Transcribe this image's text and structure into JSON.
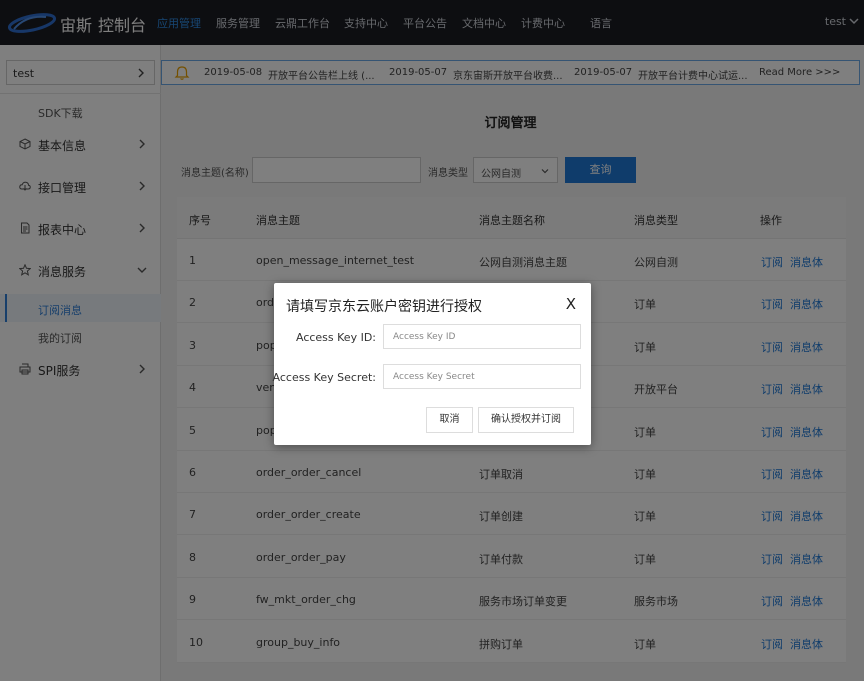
{
  "header": {
    "brand": "宙斯",
    "console": "控制台",
    "nav": [
      {
        "label": "应用管理",
        "active": true
      },
      {
        "label": "服务管理"
      },
      {
        "label": "云鼎工作台"
      },
      {
        "label": "支持中心"
      },
      {
        "label": "平台公告"
      },
      {
        "label": "文档中心"
      },
      {
        "label": "计费中心"
      },
      {
        "label": "语言"
      }
    ],
    "user": "test"
  },
  "sidebar": {
    "app_select": "test",
    "sdk_label": "SDK下载",
    "items": [
      {
        "label": "基本信息",
        "icon": "cube-icon"
      },
      {
        "label": "接口管理",
        "icon": "cloud-icon"
      },
      {
        "label": "报表中心",
        "icon": "document-icon"
      },
      {
        "label": "消息服务",
        "icon": "star-icon",
        "expanded": true
      },
      {
        "label": "SPI服务",
        "icon": "printer-icon"
      }
    ],
    "sub_items": [
      {
        "label": "订阅消息",
        "active": true
      },
      {
        "label": "我的订阅"
      }
    ]
  },
  "notice": {
    "items": [
      {
        "date": "2019-05-08",
        "text": "开放平台公告栏上线 (..."
      },
      {
        "date": "2019-05-07",
        "text": "京东宙斯开放平台收费..."
      },
      {
        "date": "2019-05-07",
        "text": "开放平台计费中心试运..."
      }
    ],
    "more": "Read More >>>"
  },
  "main": {
    "title": "订阅管理",
    "filter": {
      "topic_label": "消息主题(名称)",
      "topic_value": "",
      "type_label": "消息类型",
      "type_value": "公网自测",
      "query_button": "查询"
    },
    "table": {
      "headers": [
        "序号",
        "消息主题",
        "消息主题名称",
        "消息类型",
        "操作"
      ],
      "rows": [
        [
          "1",
          "open_message_internet_test",
          "公网自测消息主题",
          "公网自测"
        ],
        [
          "2",
          "ord",
          "",
          "订单"
        ],
        [
          "3",
          "pop",
          "",
          "订单"
        ],
        [
          "4",
          "ven",
          "",
          "开放平台"
        ],
        [
          "5",
          "pop",
          "",
          "订单"
        ],
        [
          "6",
          "order_order_cancel",
          "订单取消",
          "订单"
        ],
        [
          "7",
          "order_order_create",
          "订单创建",
          "订单"
        ],
        [
          "8",
          "order_order_pay",
          "订单付款",
          "订单"
        ],
        [
          "9",
          "fw_mkt_order_chg",
          "服务市场订单变更",
          "服务市场"
        ],
        [
          "10",
          "group_buy_info",
          "拼购订单",
          "订单"
        ]
      ],
      "action_subscribe": "订阅",
      "action_body": "消息体"
    }
  },
  "modal": {
    "title": "请填写京东云账户密钥进行授权",
    "close": "X",
    "fields": [
      {
        "label": "Access Key ID:",
        "placeholder": "Access Key ID",
        "value": ""
      },
      {
        "label": "Access Key Secret:",
        "placeholder": "Access Key Secret",
        "value": ""
      }
    ],
    "cancel": "取消",
    "confirm": "确认授权并订阅"
  },
  "colors": {
    "topbar": "#1b1c22",
    "accent": "#1e78d6",
    "link": "#1e78d6"
  }
}
